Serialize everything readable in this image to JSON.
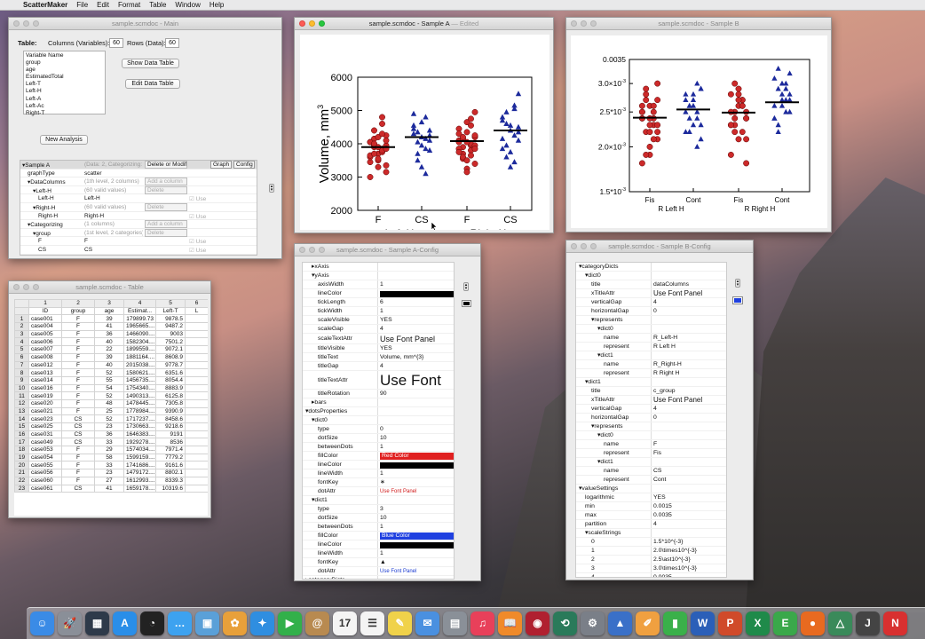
{
  "menubar": {
    "apple": "",
    "app": "ScatterMaker",
    "items": [
      "File",
      "Edit",
      "Format",
      "Table",
      "Window",
      "Help"
    ]
  },
  "colors": {
    "red_dot": "#cc2a2a",
    "blue_dot": "#1c2a9c",
    "accent_blue": "#1f40e0"
  },
  "main": {
    "title": "sample.scmdoc - Main",
    "table_label": "Table:",
    "cols_label": "Columns (Variables):",
    "cols_value": "60",
    "rows_label": "Rows (Data):",
    "rows_value": "60",
    "variables": [
      "Variable Name",
      "group",
      "age",
      "EstimatedTotal",
      "Left-T",
      "Left-H",
      "Left-A",
      "Left-Ac",
      "Right-T"
    ],
    "show_btn": "Show Data Table",
    "edit_btn": "Edit Data Table",
    "new_btn": "New Analysis",
    "tree": [
      {
        "n": "▾Sample A",
        "d": "(Data: 2, Categorizing: 1)",
        "a": "Delete or Modify",
        "g": "Graph",
        "c": "Config",
        "ind": 0
      },
      {
        "n": "graphType",
        "d": "scatter",
        "ind": 1
      },
      {
        "n": "▾DataColumns",
        "d": "(1th level, 2 columns)",
        "a": "Add a column",
        "ind": 1
      },
      {
        "n": "▾Left-H",
        "d": "(60 valid values)",
        "a": "Delete",
        "ind": 2
      },
      {
        "n": "Left-H",
        "d": "Left-H",
        "u": "Use",
        "ind": 3
      },
      {
        "n": "▾Right-H",
        "d": "(60 valid values)",
        "a": "Delete",
        "ind": 2
      },
      {
        "n": "Right-H",
        "d": "Right-H",
        "u": "Use",
        "ind": 3
      },
      {
        "n": "▾Categorizing",
        "d": "(1 columns)",
        "a": "Add a column",
        "ind": 1
      },
      {
        "n": "▾group",
        "d": "(1st level, 2 categories)",
        "a": "Delete",
        "ind": 2
      },
      {
        "n": "F",
        "d": "F",
        "u": "Use",
        "ind": 3
      },
      {
        "n": "CS",
        "d": "CS",
        "u": "Use",
        "ind": 3
      }
    ]
  },
  "table": {
    "title": "sample.scmdoc - Table",
    "col_numbers": [
      "1",
      "2",
      "3",
      "4",
      "5",
      "6"
    ],
    "headers": [
      "ID",
      "group",
      "age",
      "Estimat...",
      "Left-T",
      "L"
    ],
    "rows": [
      [
        "1",
        "case001",
        "F",
        "39",
        "179899.73",
        "9878.5"
      ],
      [
        "2",
        "case004",
        "F",
        "41",
        "1965665....",
        "9487.2"
      ],
      [
        "3",
        "case005",
        "F",
        "36",
        "1466090....",
        "9003"
      ],
      [
        "4",
        "case006",
        "F",
        "40",
        "1582304....",
        "7501.2"
      ],
      [
        "5",
        "case007",
        "F",
        "22",
        "1899559....",
        "9072.1"
      ],
      [
        "6",
        "case008",
        "F",
        "39",
        "1881164....",
        "8608.9"
      ],
      [
        "7",
        "case012",
        "F",
        "40",
        "2015038....",
        "9778.7"
      ],
      [
        "8",
        "case013",
        "F",
        "52",
        "1580621....",
        "6351.6"
      ],
      [
        "9",
        "case014",
        "F",
        "55",
        "1456735....",
        "8054.4"
      ],
      [
        "10",
        "case016",
        "F",
        "54",
        "1754340....",
        "8883.9"
      ],
      [
        "11",
        "case019",
        "F",
        "52",
        "1490313....",
        "6125.8"
      ],
      [
        "12",
        "case020",
        "F",
        "48",
        "1478445....",
        "7305.8"
      ],
      [
        "13",
        "case021",
        "F",
        "25",
        "1778984....",
        "9390.9"
      ],
      [
        "14",
        "case023",
        "CS",
        "52",
        "1717237....",
        "8458.6"
      ],
      [
        "15",
        "case025",
        "CS",
        "23",
        "1730663....",
        "9218.6"
      ],
      [
        "16",
        "case031",
        "CS",
        "36",
        "1646383....",
        "9191"
      ],
      [
        "17",
        "case049",
        "CS",
        "33",
        "1929278....",
        "8536"
      ],
      [
        "18",
        "case053",
        "F",
        "29",
        "1574034....",
        "7971.4"
      ],
      [
        "19",
        "case054",
        "F",
        "58",
        "1599159....",
        "7779.2"
      ],
      [
        "20",
        "case055",
        "F",
        "33",
        "1741686....",
        "9161.6"
      ],
      [
        "21",
        "case056",
        "F",
        "23",
        "1479172....",
        "8802.1"
      ],
      [
        "22",
        "case060",
        "F",
        "27",
        "1612993....",
        "8339.3"
      ],
      [
        "23",
        "case061",
        "CS",
        "41",
        "1659178....",
        "10319.6"
      ]
    ]
  },
  "sampleA": {
    "title": "sample.scmdoc - Sample A",
    "edited": "— Edited",
    "ylabel": "Volume, mm",
    "ylabel_sup": "3",
    "yticks": [
      "6000",
      "5000",
      "4000",
      "3000",
      "2000"
    ],
    "xticks": [
      "F",
      "CS",
      "F",
      "CS"
    ],
    "groups": [
      "Left-H",
      "Right-H"
    ]
  },
  "sampleB": {
    "title": "sample.scmdoc - Sample B",
    "yticks": [
      "0.0035",
      "3.0×10",
      "2.5*10",
      "2.0×10",
      "1.5*10"
    ],
    "yticks_sup": "-3",
    "xticks": [
      "Fis",
      "Cont",
      "Fis",
      "Cont"
    ],
    "groups": [
      "R Left H",
      "R Right H"
    ]
  },
  "chart_data": [
    {
      "type": "scatter",
      "ylabel": "Volume, mm^3",
      "ylim": [
        2000,
        6000
      ],
      "categories": [
        "F",
        "CS",
        "F",
        "CS"
      ],
      "groups": [
        "Left-H",
        "Right-H"
      ],
      "series": [
        {
          "values": [
            3450,
            3700,
            3950,
            4150,
            3850,
            3600,
            3300,
            4250,
            3900,
            3750,
            4050,
            3500,
            3150,
            4400,
            3800,
            3650,
            4200,
            3350,
            3950,
            4600,
            3000,
            3900,
            4100,
            3700,
            4300,
            4050,
            3550,
            3850,
            4000,
            4800
          ]
        },
        {
          "values": [
            3850,
            4300,
            4650,
            4100,
            3500,
            4800,
            4450,
            3950,
            4250,
            3700,
            4150,
            4550,
            3300,
            4400,
            4050,
            3100,
            4900,
            4200,
            3800,
            4350
          ]
        },
        {
          "values": [
            3700,
            3950,
            4100,
            4350,
            4200,
            3550,
            3800,
            4050,
            4650,
            3400,
            3900,
            4000,
            4450,
            3250,
            4250,
            3600,
            4550,
            3850,
            3150,
            4950,
            4150,
            3650,
            4300,
            3500,
            3950,
            4200,
            4750,
            3750,
            4050,
            3850
          ]
        },
        {
          "values": [
            4100,
            4600,
            5050,
            3850,
            4400,
            5500,
            3600,
            4250,
            4800,
            3300,
            4500,
            3950,
            5150,
            4700,
            3750,
            4350,
            4950,
            3450,
            4150,
            4550
          ]
        }
      ],
      "means": [
        3900,
        4200,
        4080,
        4400
      ]
    },
    {
      "type": "scatter",
      "ylim": [
        0.0015,
        0.0035
      ],
      "categories": [
        "Fis",
        "Cont",
        "Fis",
        "Cont"
      ],
      "groups": [
        "R Left H",
        "R Right H"
      ],
      "series": [
        {
          "values": [
            0.0024,
            0.0026,
            0.0021,
            0.0028,
            0.0023,
            0.0025,
            0.0019,
            0.0027,
            0.0022,
            0.0024,
            0.0026,
            0.002,
            0.0023,
            0.0029,
            0.0025,
            0.0018,
            0.0024,
            0.0022,
            0.0027,
            0.0021,
            0.0025,
            0.0023,
            0.003,
            0.0019,
            0.0026,
            0.0024,
            0.0022
          ]
        },
        {
          "values": [
            0.0025,
            0.0027,
            0.0023,
            0.0029,
            0.0026,
            0.0024,
            0.0022,
            0.0028,
            0.0021,
            0.0026,
            0.003,
            0.0025,
            0.0027,
            0.0023,
            0.0024,
            0.002,
            0.0028,
            0.0026,
            0.0029,
            0.0022
          ]
        },
        {
          "values": [
            0.0025,
            0.0027,
            0.0023,
            0.0029,
            0.0024,
            0.0022,
            0.0026,
            0.0028,
            0.0021,
            0.0025,
            0.0023,
            0.0027,
            0.0019,
            0.0026,
            0.0024,
            0.003,
            0.0022,
            0.0025,
            0.0028,
            0.0018,
            0.0024,
            0.0026,
            0.0023,
            0.0027,
            0.0021
          ]
        },
        {
          "values": [
            0.0027,
            0.0029,
            0.0025,
            0.0031,
            0.0026,
            0.0028,
            0.0023,
            0.003,
            0.0024,
            0.0027,
            0.0032,
            0.0022,
            0.0029,
            0.0026,
            0.0028,
            0.0025,
            0.0033,
            0.0027,
            0.0024,
            0.003
          ]
        }
      ],
      "means": [
        0.00241,
        0.00254,
        0.00249,
        0.00266
      ]
    }
  ],
  "configA": {
    "title": "sample.scmdoc - Sample A-Config",
    "rows": [
      [
        "▸xAxis",
        "",
        1
      ],
      [
        "▾yAxis",
        "",
        1
      ],
      [
        "axisWidth",
        "1",
        2
      ],
      [
        "lineColor",
        "#black",
        2
      ],
      [
        "tickLength",
        "6",
        2
      ],
      [
        "tickWidth",
        "1",
        2
      ],
      [
        "scaleVisible",
        "YES",
        2
      ],
      [
        "scaleGap",
        "4",
        2
      ],
      [
        "scaleTextAttr",
        "Use Font Panel",
        2,
        "font-m"
      ],
      [
        "titleVisible",
        "YES",
        2
      ],
      [
        "titleText",
        "Volume, mm^{3}",
        2
      ],
      [
        "titleGap",
        "4",
        2
      ],
      [
        "titleTextAttr",
        "Use Font",
        2,
        "font-l"
      ],
      [
        "titleRotation",
        "90",
        2
      ],
      [
        "▸bars",
        "",
        1
      ],
      [
        "▾dotsProperties",
        "",
        0
      ],
      [
        "▾dict0",
        "",
        1
      ],
      [
        "type",
        "0",
        2
      ],
      [
        "dotSize",
        "10",
        2
      ],
      [
        "betweenDots",
        "1",
        2
      ],
      [
        "fillColor",
        "Red Color",
        2,
        "red"
      ],
      [
        "lineColor",
        "#black",
        2
      ],
      [
        "lineWidth",
        "1",
        2
      ],
      [
        "fontKey",
        "∗",
        2
      ],
      [
        "dotAttr",
        "Use Font Panel",
        2,
        "red-text"
      ],
      [
        "▾dict1",
        "",
        1
      ],
      [
        "type",
        "3",
        2
      ],
      [
        "dotSize",
        "10",
        2
      ],
      [
        "betweenDots",
        "1",
        2
      ],
      [
        "fillColor",
        "Blue Color",
        2,
        "blue"
      ],
      [
        "lineColor",
        "#black",
        2
      ],
      [
        "lineWidth",
        "1",
        2
      ],
      [
        "fontKey",
        "▲",
        2
      ],
      [
        "dotAttr",
        "Use Font Panel",
        2,
        "blue-text"
      ],
      [
        "▸categoryDicts",
        "",
        0
      ]
    ]
  },
  "configB": {
    "title": "sample.scmdoc - Sample B-Config",
    "rows": [
      [
        "▾categoryDicts",
        "",
        0
      ],
      [
        "▾dict0",
        "",
        1
      ],
      [
        "title",
        "dataColumns",
        2
      ],
      [
        "xTitleAttr",
        "Use Font Panel",
        2,
        "font-s"
      ],
      [
        "verticalGap",
        "4",
        2
      ],
      [
        "horizontalGap",
        "0",
        2
      ],
      [
        "▾represents",
        "",
        2
      ],
      [
        "▾dict0",
        "",
        3
      ],
      [
        "name",
        "R_Left-H",
        4
      ],
      [
        "represent",
        "R Left H",
        4
      ],
      [
        "▾dict1",
        "",
        3
      ],
      [
        "name",
        "R_Right-H",
        4
      ],
      [
        "represent",
        "R Right H",
        4
      ],
      [
        "▾dict1",
        "",
        1
      ],
      [
        "title",
        "c_group",
        2
      ],
      [
        "xTitleAttr",
        "Use Font Panel",
        2,
        "font-s"
      ],
      [
        "verticalGap",
        "4",
        2
      ],
      [
        "horizontalGap",
        "0",
        2
      ],
      [
        "▾represents",
        "",
        2
      ],
      [
        "▾dict0",
        "",
        3
      ],
      [
        "name",
        "F",
        4
      ],
      [
        "represent",
        "Fis",
        4
      ],
      [
        "▾dict1",
        "",
        3
      ],
      [
        "name",
        "CS",
        4
      ],
      [
        "represent",
        "Cont",
        4
      ],
      [
        "▾valueSettings",
        "",
        0
      ],
      [
        "logarithmic",
        "YES",
        1
      ],
      [
        "min",
        "0.0015",
        1
      ],
      [
        "max",
        "0.0035",
        1
      ],
      [
        "partition",
        "4",
        1
      ],
      [
        "▾scaleStrings",
        "",
        1
      ],
      [
        "0",
        "1.5*10^{-3}",
        2
      ],
      [
        "1",
        "2.0\\times10^{-3}",
        2
      ],
      [
        "2",
        "2.5\\ast10^{-3}",
        2
      ],
      [
        "3",
        "3.0\\times10^{-3}",
        2
      ],
      [
        "4",
        "0.0035",
        2
      ]
    ]
  },
  "dock": [
    {
      "name": "finder-icon",
      "c": "#3a8be6",
      "g": "☺"
    },
    {
      "name": "launchpad-icon",
      "c": "#8a8f98",
      "g": "🚀"
    },
    {
      "name": "mission-control-icon",
      "c": "#2e3a4a",
      "g": "▦"
    },
    {
      "name": "app-store-icon",
      "c": "#2a8ee8",
      "g": "A"
    },
    {
      "name": "dashboard-icon",
      "c": "#222",
      "g": "◔"
    },
    {
      "name": "messages-icon",
      "c": "#3da2f0",
      "g": "…"
    },
    {
      "name": "preview-icon",
      "c": "#5aa0d8",
      "g": "▣"
    },
    {
      "name": "photos-icon",
      "c": "#e8a03a",
      "g": "✿"
    },
    {
      "name": "safari-icon",
      "c": "#2f8ee0",
      "g": "✦"
    },
    {
      "name": "facetime-icon",
      "c": "#32b04a",
      "g": "▶"
    },
    {
      "name": "contacts-icon",
      "c": "#b88a50",
      "g": "@"
    },
    {
      "name": "calendar-icon",
      "c": "#f4f4f4",
      "g": "17"
    },
    {
      "name": "reminders-icon",
      "c": "#f4f4f4",
      "g": "☰"
    },
    {
      "name": "notes-icon",
      "c": "#f0d24a",
      "g": "✎"
    },
    {
      "name": "mail-icon",
      "c": "#4a90e0",
      "g": "✉"
    },
    {
      "name": "image-capture-icon",
      "c": "#8a9098",
      "g": "▤"
    },
    {
      "name": "itunes-icon",
      "c": "#e8405a",
      "g": "♫"
    },
    {
      "name": "ibooks-icon",
      "c": "#f08a2a",
      "g": "📖"
    },
    {
      "name": "photo-booth-icon",
      "c": "#b02030",
      "g": "◉"
    },
    {
      "name": "time-machine-icon",
      "c": "#2a7a5a",
      "g": "⟲"
    },
    {
      "name": "system-preferences-icon",
      "c": "#7a7f88",
      "g": "⚙"
    },
    {
      "name": "keynote-icon",
      "c": "#3a70c8",
      "g": "▲"
    },
    {
      "name": "pages-icon",
      "c": "#f0a040",
      "g": "✐"
    },
    {
      "name": "numbers-icon",
      "c": "#3ab04a",
      "g": "▮"
    },
    {
      "name": "word-icon",
      "c": "#2b5fb8",
      "g": "W"
    },
    {
      "name": "powerpoint-icon",
      "c": "#d04a2a",
      "g": "P"
    },
    {
      "name": "excel-icon",
      "c": "#1f8a4a",
      "g": "X"
    },
    {
      "name": "evernote-icon",
      "c": "#3aa84a",
      "g": "E"
    },
    {
      "name": "firefox-icon",
      "c": "#e86a20",
      "g": "●"
    },
    {
      "name": "scattermaker-icon",
      "c": "#3a8a5a",
      "g": "△"
    },
    {
      "name": "java-icon",
      "c": "#444",
      "g": "J"
    },
    {
      "name": "news-icon",
      "c": "#d83030",
      "g": "N"
    }
  ]
}
